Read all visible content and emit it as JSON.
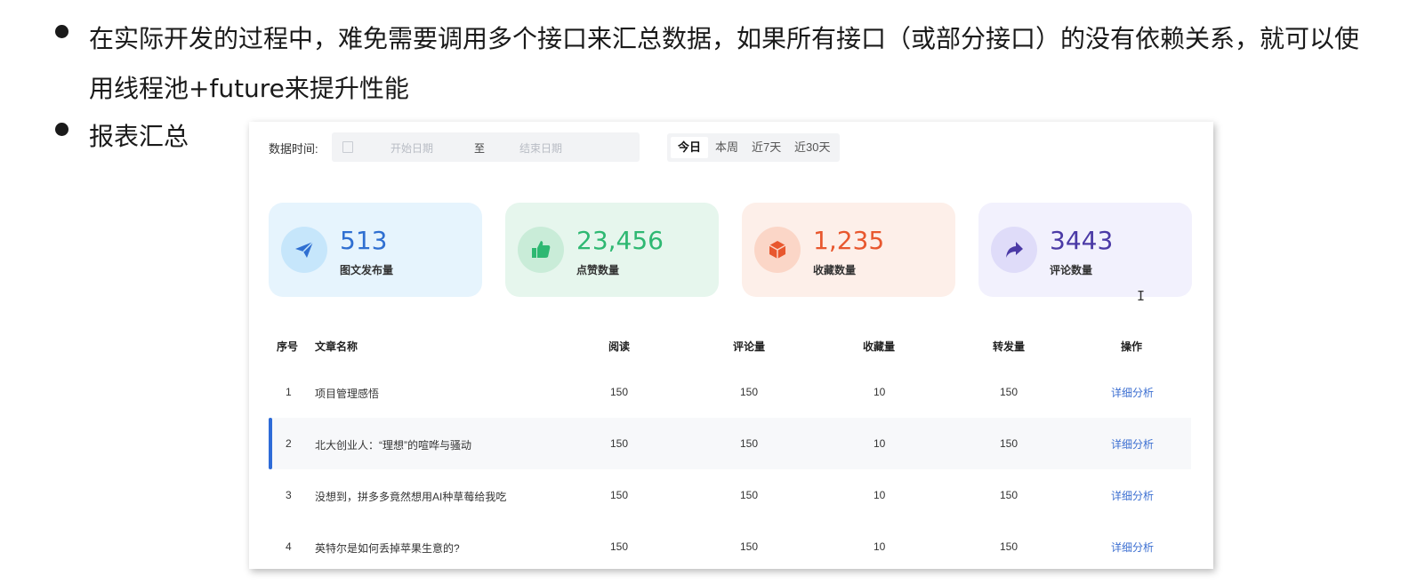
{
  "bullets": [
    "在实际开发的过程中，难免需要调用多个接口来汇总数据，如果所有接口（或部分接口）的没有依赖关系，就可以使用线程池+future来提升性能",
    "报表汇总"
  ],
  "filter": {
    "label": "数据时间:",
    "start_placeholder": "开始日期",
    "separator": "至",
    "end_placeholder": "结束日期",
    "ranges": [
      "今日",
      "本周",
      "近7天",
      "近30天"
    ],
    "active_range": "今日"
  },
  "cards": [
    {
      "value": "513",
      "label": "图文发布量",
      "icon": "paper-plane-icon",
      "bg": "#e6f4fd",
      "circle": "#c6e6fb",
      "color": "#2f6fd1"
    },
    {
      "value": "23,456",
      "label": "点赞数量",
      "icon": "thumbs-up-icon",
      "bg": "#e6f6ed",
      "circle": "#c9ecd8",
      "color": "#2eb872"
    },
    {
      "value": "1,235",
      "label": "收藏数量",
      "icon": "box-icon",
      "bg": "#fdefe9",
      "circle": "#fbd6c7",
      "color": "#e8572e"
    },
    {
      "value": "3443",
      "label": "评论数量",
      "icon": "share-arrow-icon",
      "bg": "#f2f1fd",
      "circle": "#dfdcf9",
      "color": "#4b3aa6"
    }
  ],
  "table": {
    "headers": [
      "序号",
      "文章名称",
      "阅读",
      "评论量",
      "收藏量",
      "转发量",
      "操作"
    ],
    "rows": [
      {
        "no": "1",
        "title": "项目管理感悟",
        "read": "150",
        "comments": "150",
        "favorites": "10",
        "shares": "150",
        "action": "详细分析"
      },
      {
        "no": "2",
        "title": "北大创业人：“理想”的喧哗与骚动",
        "read": "150",
        "comments": "150",
        "favorites": "10",
        "shares": "150",
        "action": "详细分析"
      },
      {
        "no": "3",
        "title": "没想到，拼多多竟然想用AI种草莓给我吃",
        "read": "150",
        "comments": "150",
        "favorites": "10",
        "shares": "150",
        "action": "详细分析"
      },
      {
        "no": "4",
        "title": "英特尔是如何丢掉苹果生意的?",
        "read": "150",
        "comments": "150",
        "favorites": "10",
        "shares": "150",
        "action": "详细分析"
      }
    ]
  }
}
